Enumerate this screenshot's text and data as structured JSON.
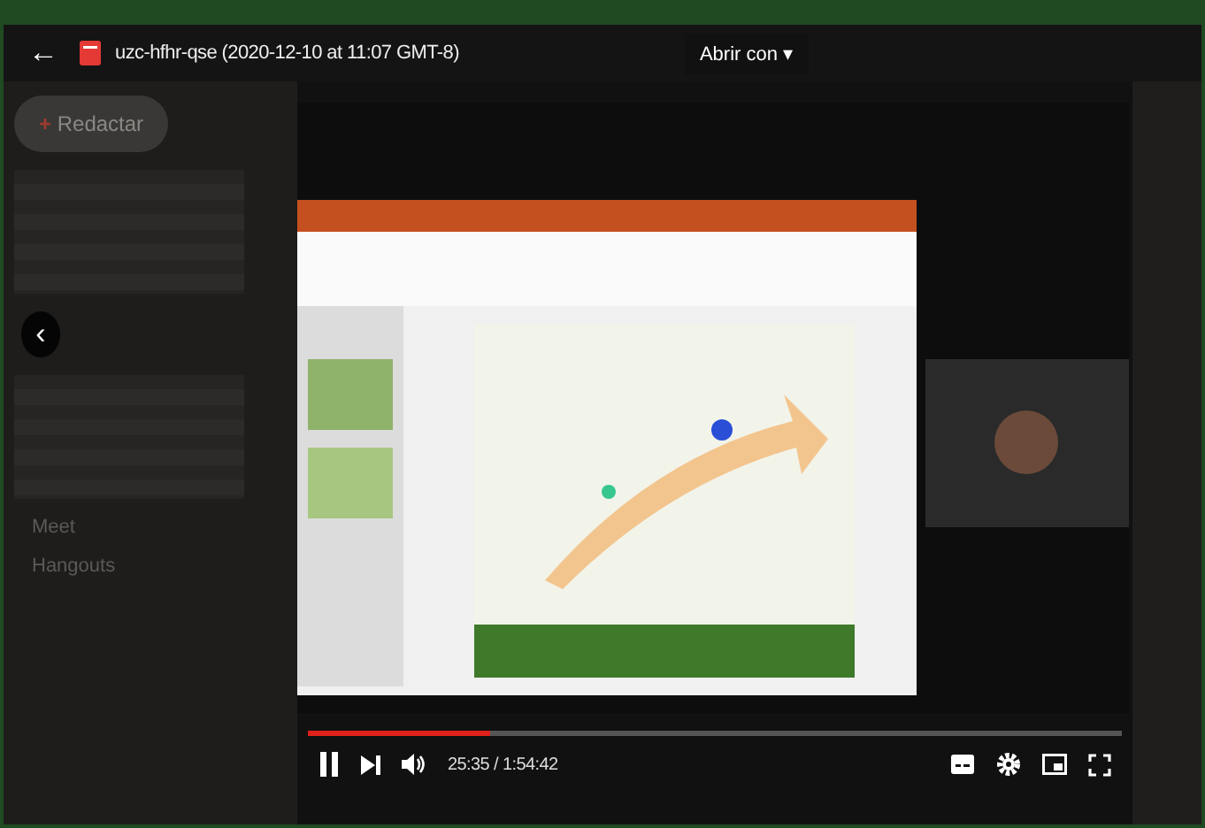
{
  "top_bar": {
    "back": "←",
    "file_name": "uzc-hfhr-qse (2020-12-10 at 11:07 GMT-8)",
    "open_with": "Abrir con",
    "open_with_caret": "▾"
  },
  "background": {
    "compose_plus": "+",
    "compose": "Redactar",
    "sections": [
      "Meet",
      "Hangouts"
    ],
    "prev": "‹"
  },
  "player": {
    "progress": {
      "level": 0.223
    },
    "time": "25:35 / 1:54:42",
    "playing": true
  }
}
